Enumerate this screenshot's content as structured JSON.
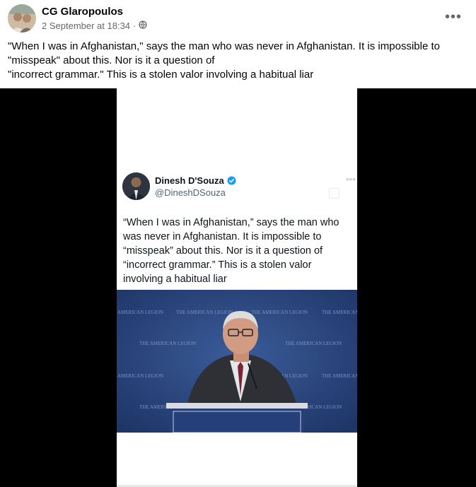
{
  "post": {
    "author": "CG Glaropoulos",
    "date": "2 September at 18:34",
    "separator": "·",
    "audience_icon": "globe-icon",
    "more_label": "•••",
    "text_lines": [
      "\"When I was in Afghanistan,\" says the man who was never in Afghanistan. It is impossible to",
      "\"misspeak\" about this. Nor is it a question of",
      "\"incorrect grammar.\" This is a stolen valor involving a habitual liar"
    ]
  },
  "tweet": {
    "name": "Dinesh D'Souza",
    "handle": "@DineshDSouza",
    "verified_icon": "verified-badge-icon",
    "verified_color": "#1d9bf0",
    "more_label": "•••",
    "lines": [
      "“When I was in Afghanistan,” says the man who",
      "was never in Afghanistan. It is impossible to",
      "“misspeak” about this. Nor is it a question of",
      "“incorrect grammar.” This is a stolen valor",
      "involving a habitual liar"
    ]
  },
  "photo": {
    "backdrop_color": "#2d4a82",
    "backdrop_logos": [
      "THE AMERICAN LEGION",
      "THE AMERICAN LEGION",
      "THE AMERICAN LEGION",
      "THE AMERICAN LEGION",
      "THE AMERICAN LEGION",
      "THE AMERICAN LEGION",
      "THE AMERICAN LEGION",
      "THE AMERICAN LEGION",
      "THE AMERICAN LEGION",
      "THE AMERICAN LEGION",
      "THE AMERICAN LEGION"
    ]
  },
  "colors": {
    "media_background": "#000000",
    "text_primary": "#050505",
    "text_secondary": "#65676b"
  }
}
